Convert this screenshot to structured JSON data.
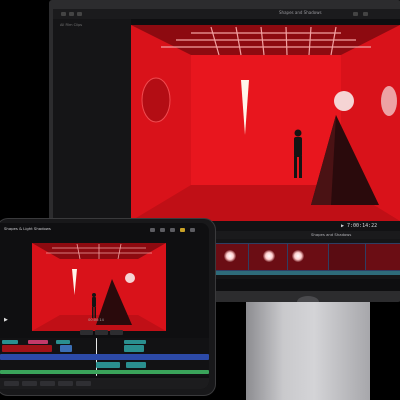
{
  "monitor": {
    "project_title": "Shapes and Shadows",
    "library_label": "All Film Clips",
    "timecode": "7:00:14:22",
    "timeline_title": "Shapes and Shadows",
    "play_glyph": "▶"
  },
  "ipad": {
    "project_title": "Shapes & Light Shadows",
    "timecode": "00:00:14",
    "play_glyph": "▶"
  },
  "colors": {
    "scene_red": "#e0141c",
    "pyramid": "#2a0a0c",
    "clip_blue": "#2c4aa8",
    "clip_teal": "#2a8f8f",
    "clip_green": "#3aa35a"
  },
  "icons": [
    "play-icon",
    "share-icon",
    "settings-icon",
    "search-icon"
  ]
}
